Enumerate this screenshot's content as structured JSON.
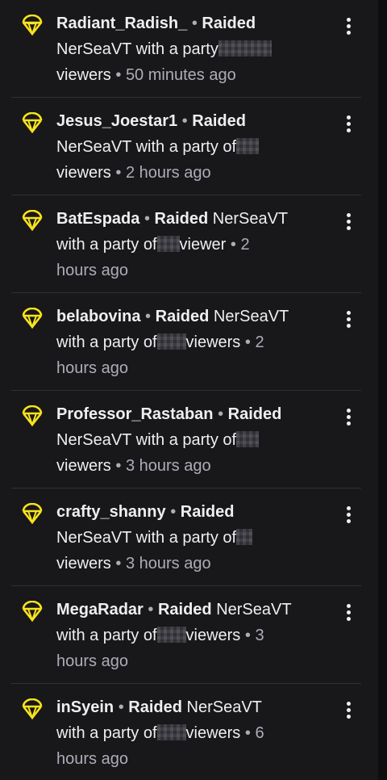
{
  "accent_color": "#f9e41b",
  "icons": {
    "raid": "raid-icon",
    "more": "more-options-icon"
  },
  "feed": [
    {
      "username": "Radiant_Radish_",
      "action": "Raided",
      "line1_rest": "",
      "line2": "NerSeaVT with a party",
      "line2_after": "",
      "line3": "viewers",
      "time": "50 minutes ago",
      "line4": "",
      "line3_time": "50 minutes ago"
    },
    {
      "username": "Jesus_Joestar1",
      "action": "Raided",
      "line1_rest": "",
      "line2": "NerSeaVT with a party of",
      "line2_after": "",
      "line3": "viewers",
      "time": "2 hours ago",
      "line4": ""
    },
    {
      "username": "BatEspada",
      "action": "Raided",
      "line1_rest": "NerSeaVT",
      "line2": "with a party of",
      "line2_after": "viewer",
      "line3": "",
      "time": "2",
      "line4": "hours ago"
    },
    {
      "username": "belabovina",
      "action": "Raided",
      "line1_rest": "NerSeaVT",
      "line2": "with a party of",
      "line2_after": "viewers",
      "line3": "",
      "time": "2",
      "line4": "hours ago"
    },
    {
      "username": "Professor_Rastaban",
      "action": "Raided",
      "line1_rest": "",
      "line2": "NerSeaVT with a party of",
      "line2_after": "",
      "line3": "viewers",
      "time": "3 hours ago",
      "line4": ""
    },
    {
      "username": "crafty_shanny",
      "action": "Raided",
      "line1_rest": "",
      "line2": "NerSeaVT with a party of",
      "line2_after": "",
      "line3": "viewers",
      "time": "3 hours ago",
      "line4": ""
    },
    {
      "username": "MegaRadar",
      "action": "Raided",
      "line1_rest": "NerSeaVT",
      "line2": "with a party of",
      "line2_after": "viewers",
      "line3": "",
      "time": "3",
      "line4": "hours ago"
    },
    {
      "username": "inSyein",
      "action": "Raided",
      "line1_rest": "NerSeaVT",
      "line2": "with a party of",
      "line2_after": "viewers",
      "line3": "",
      "time": "6",
      "line4": "hours ago"
    }
  ]
}
